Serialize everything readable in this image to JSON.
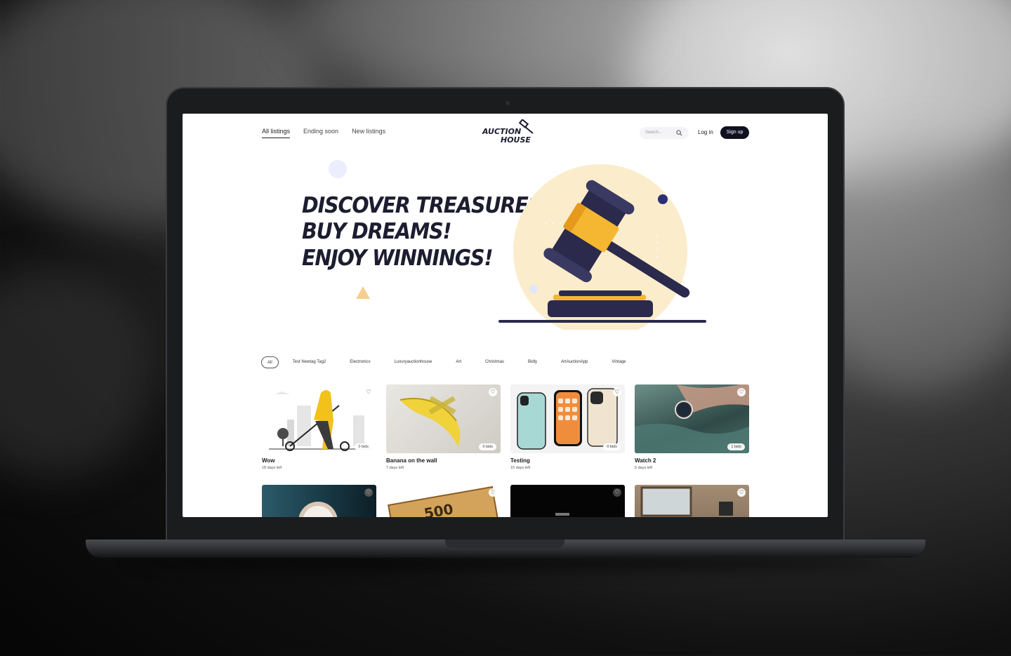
{
  "brand": {
    "logo_line1": "AUCTION",
    "logo_line2": "HOUSE"
  },
  "nav": {
    "items": [
      {
        "label": "All listings",
        "active": true
      },
      {
        "label": "Ending soon",
        "active": false
      },
      {
        "label": "New listings",
        "active": false
      }
    ]
  },
  "header": {
    "search_placeholder": "Search...",
    "login": "Log in",
    "signup": "Sign up"
  },
  "hero": {
    "lines": [
      "DISCOVER TREASURES,",
      "BUY DREAMS!",
      "ENJOY WINNINGS!"
    ]
  },
  "filters": [
    "All",
    "Test Newtag Tag2",
    "Electronics",
    "Luxuryauctionhouse",
    "Art",
    "Christmas",
    "Bidly",
    "ArtAuctionApp",
    "Vintage"
  ],
  "listings": [
    {
      "title": "Wow",
      "days": "18 days left",
      "bids": "0 bids",
      "image": "scooter-illustration"
    },
    {
      "title": "Banana on the wall",
      "days": "7 days left",
      "bids": "0 bids",
      "image": "banana-taped"
    },
    {
      "title": "Testing",
      "days": "15 days left",
      "bids": "0 bids",
      "image": "iphones"
    },
    {
      "title": "Watch 2",
      "days": "5 days left",
      "bids": "1 bids",
      "image": "watch-water"
    }
  ],
  "listings_row2": [
    {
      "image": "watch-closeup"
    },
    {
      "image": "monopoly-500-note",
      "text": "500"
    },
    {
      "image": "dark-product"
    },
    {
      "image": "window-room"
    }
  ],
  "colors": {
    "accent": "#101020",
    "hero_circle": "#fbeccb",
    "gavel_dark": "#2b2a4c",
    "gavel_gold": "#f5b731"
  }
}
